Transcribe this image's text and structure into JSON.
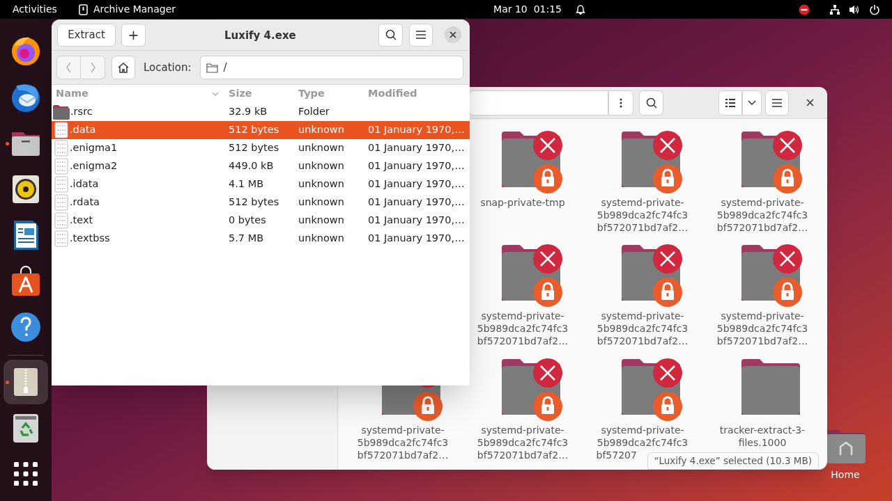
{
  "top_bar": {
    "activities": "Activities",
    "app_name": "Archive Manager",
    "clock": "Mar 10  01:15"
  },
  "dock": {
    "pinned_apps": [
      {
        "kind": "browser",
        "running": false,
        "selected": false
      },
      {
        "kind": "mail",
        "running": false,
        "selected": false
      },
      {
        "kind": "files",
        "running": true,
        "selected": false
      },
      {
        "kind": "music",
        "running": false,
        "selected": false
      },
      {
        "kind": "writer",
        "running": false,
        "selected": false
      },
      {
        "kind": "store",
        "running": false,
        "selected": false
      },
      {
        "kind": "help",
        "running": false,
        "selected": false
      }
    ],
    "other_apps": [
      {
        "kind": "archive",
        "running": true,
        "selected": true
      },
      {
        "kind": "trash",
        "running": false,
        "selected": false
      },
      {
        "kind": "app-grid",
        "running": false,
        "selected": false
      }
    ]
  },
  "desktop_icons": [
    {
      "label": "Home"
    }
  ],
  "files_window": {
    "rows": [
      [
        "",
        {
          "lines": [
            "snap-private-tmp"
          ],
          "locked": true
        },
        {
          "lines": [
            "systemd-private-",
            "5b989dca2fc74fc3",
            "bf572071bd7af2…"
          ],
          "locked": true
        },
        {
          "lines": [
            "systemd-private-",
            "5b989dca2fc74fc3",
            "bf572071bd7af2…"
          ],
          "locked": true
        }
      ],
      [
        "",
        {
          "lines": [
            "systemd-private-",
            "5b989dca2fc74fc3",
            "bf572071bd7af2…"
          ],
          "locked": true
        },
        {
          "lines": [
            "systemd-private-",
            "5b989dca2fc74fc3",
            "bf572071bd7af2…"
          ],
          "locked": true
        },
        {
          "lines": [
            "systemd-private-",
            "5b989dca2fc74fc3",
            "bf572071bd7af2…"
          ],
          "locked": true
        }
      ],
      [
        {
          "lines": [
            "systemd-private-",
            "5b989dca2fc74fc3",
            "bf572071bd7af2…"
          ],
          "locked": true
        },
        {
          "lines": [
            "systemd-private-",
            "5b989dca2fc74fc3",
            "bf572071bd7af2…"
          ],
          "locked": true
        },
        {
          "lines": [
            "systemd-private-",
            "5b989dca2fc74fc3",
            "bf57207"
          ],
          "locked": true,
          "cut": true
        },
        {
          "lines": [
            "tracker-extract-3-",
            "files.1000"
          ],
          "locked": false
        }
      ]
    ],
    "status": "“Luxify 4.exe” selected (10.3 MB)"
  },
  "archive_window": {
    "title": "Luxify 4.exe",
    "extract_button": "Extract",
    "add_button": "+",
    "location_label": "Location:",
    "location": "/",
    "columns": [
      "Name",
      "Size",
      "Type",
      "Modified"
    ],
    "rows": [
      {
        "kind": "folder",
        "name": ".rsrc",
        "size": "32.9 kB",
        "type": "Folder",
        "modified": "",
        "selected": false
      },
      {
        "kind": "file",
        "name": ".data",
        "size": "512 bytes",
        "type": "unknown",
        "modified": "01 January 1970,…",
        "selected": true
      },
      {
        "kind": "file",
        "name": ".enigma1",
        "size": "512 bytes",
        "type": "unknown",
        "modified": "01 January 1970,…",
        "selected": false
      },
      {
        "kind": "file",
        "name": ".enigma2",
        "size": "449.0 kB",
        "type": "unknown",
        "modified": "01 January 1970,…",
        "selected": false
      },
      {
        "kind": "file",
        "name": ".idata",
        "size": "4.1 MB",
        "type": "unknown",
        "modified": "01 January 1970,…",
        "selected": false
      },
      {
        "kind": "file",
        "name": ".rdata",
        "size": "512 bytes",
        "type": "unknown",
        "modified": "01 January 1970,…",
        "selected": false
      },
      {
        "kind": "file",
        "name": ".text",
        "size": "0 bytes",
        "type": "unknown",
        "modified": "01 January 1970,…",
        "selected": false
      },
      {
        "kind": "file",
        "name": ".textbss",
        "size": "5.7 MB",
        "type": "unknown",
        "modified": "01 January 1970,…",
        "selected": false
      }
    ]
  }
}
